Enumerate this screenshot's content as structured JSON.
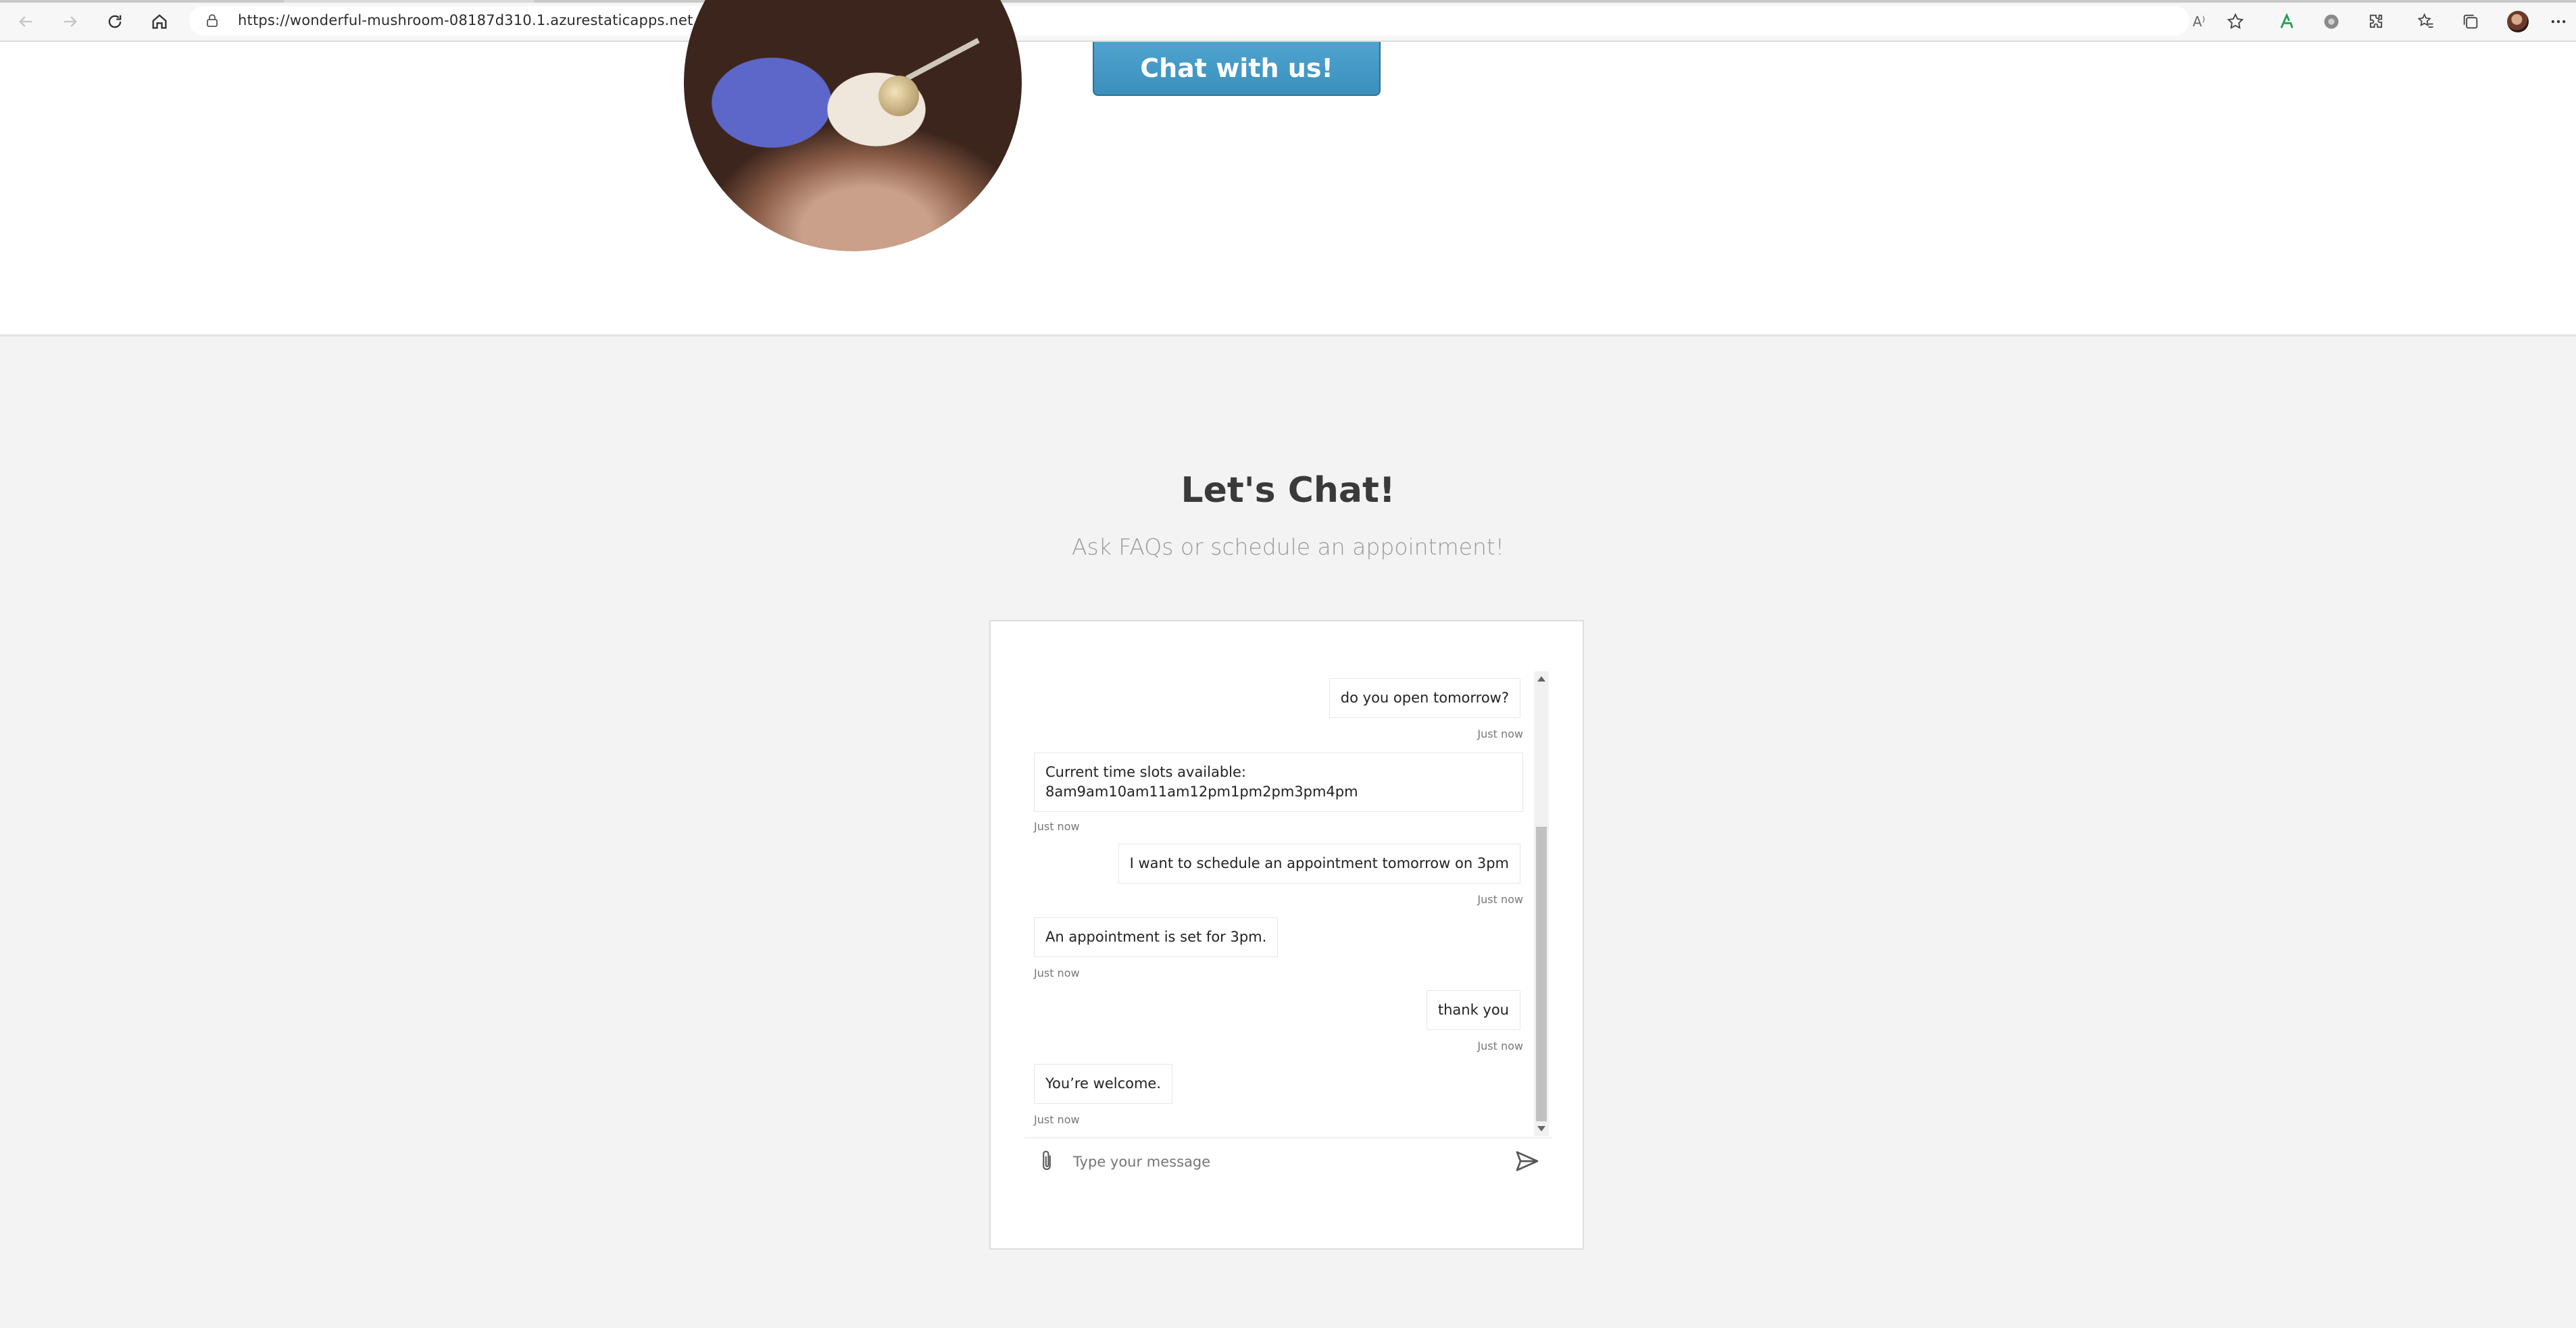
{
  "browser": {
    "url": "https://wonderful-mushroom-08187d310.1.azurestaticapps.net",
    "read_aloud_label": "A⁾"
  },
  "hero": {
    "chat_button_label": "Chat with us!"
  },
  "chat_section": {
    "title": "Let's Chat!",
    "subtitle": "Ask FAQs or schedule an appointment!"
  },
  "chat": {
    "messages": [
      {
        "from": "user",
        "text": "do you open tomorrow?",
        "time": "Just now"
      },
      {
        "from": "bot",
        "line1": "Current time slots available:",
        "line2": "8am9am10am11am12pm1pm2pm3pm4pm",
        "time": "Just now"
      },
      {
        "from": "user",
        "text": "I want to schedule an appointment tomorrow on 3pm",
        "time": "Just now"
      },
      {
        "from": "bot",
        "text": "An appointment is set for 3pm.",
        "time": "Just now"
      },
      {
        "from": "user",
        "text": "thank you",
        "time": "Just now"
      },
      {
        "from": "bot",
        "text": "You’re welcome.",
        "time": "Just now"
      }
    ],
    "input_placeholder": "Type your message"
  },
  "colors": {
    "chat_button": "#4a9fcb",
    "section_bg": "#f3f3f3",
    "scroll_thumb": "#c1c1c1"
  }
}
